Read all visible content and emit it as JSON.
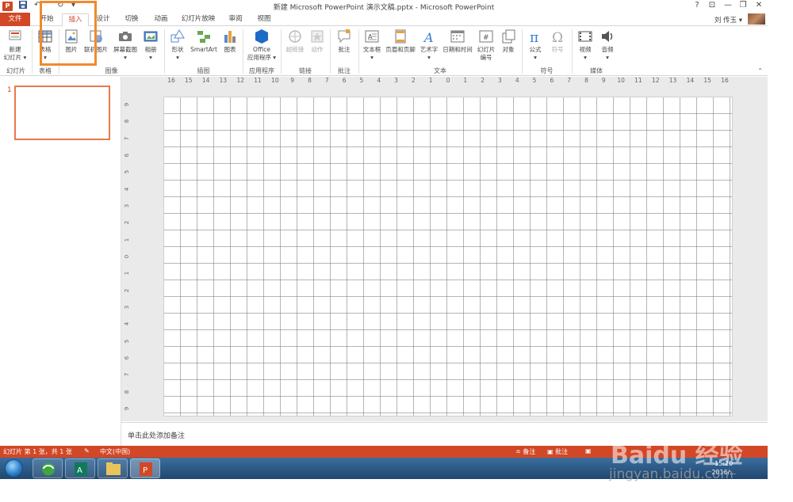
{
  "titlebar": {
    "app_icon": "P",
    "save_icon": "floppy-icon",
    "undo_icon": "↶",
    "redo_icon": "↻",
    "customize_icon": "▾",
    "title": "新建 Microsoft PowerPoint 演示文稿.pptx - Microsoft PowerPoint",
    "help": "?",
    "ribbon_display": "⊡",
    "minimize": "—",
    "restore": "❐",
    "close": "✕"
  },
  "tabs": [
    "文件",
    "开始",
    "插入",
    "设计",
    "切换",
    "动画",
    "幻灯片放映",
    "审阅",
    "视图"
  ],
  "active_tab": "插入",
  "user": {
    "name": "刘 传玉 ▾"
  },
  "ribbon": {
    "buttons": [
      {
        "label": "新建\n幻灯片 ▾",
        "icon": "new-slide-icon"
      },
      {
        "label": "表格\n▾",
        "icon": "table-icon"
      },
      {
        "label": "图片",
        "icon": "picture-icon"
      },
      {
        "label": "联机图片",
        "icon": "online-picture-icon"
      },
      {
        "label": "屏幕截图\n▾",
        "icon": "screenshot-icon"
      },
      {
        "label": "相册\n▾",
        "icon": "photo-album-icon"
      },
      {
        "label": "形状\n▾",
        "icon": "shapes-icon"
      },
      {
        "label": "SmartArt",
        "icon": "smartart-icon"
      },
      {
        "label": "图表",
        "icon": "chart-icon"
      },
      {
        "label": "Office\n应用程序 ▾",
        "icon": "office-apps-icon"
      },
      {
        "label": "超链接",
        "icon": "hyperlink-icon",
        "disabled": true
      },
      {
        "label": "动作",
        "icon": "action-icon",
        "disabled": true
      },
      {
        "label": "批注",
        "icon": "comment-icon"
      },
      {
        "label": "文本框\n▾",
        "icon": "textbox-icon"
      },
      {
        "label": "页眉和页脚",
        "icon": "header-footer-icon"
      },
      {
        "label": "艺术字\n▾",
        "icon": "wordart-icon"
      },
      {
        "label": "日期和时间",
        "icon": "date-time-icon"
      },
      {
        "label": "幻灯片\n编号",
        "icon": "slide-number-icon"
      },
      {
        "label": "对象",
        "icon": "object-icon"
      },
      {
        "label": "公式\n▾",
        "icon": "equation-icon"
      },
      {
        "label": "符号",
        "icon": "symbol-icon",
        "disabled": true
      },
      {
        "label": "视频\n▾",
        "icon": "video-icon"
      },
      {
        "label": "音频\n▾",
        "icon": "audio-icon"
      }
    ],
    "groups": [
      "幻灯片",
      "表格",
      "图像",
      "插图",
      "应用程序",
      "链接",
      "批注",
      "文本",
      "符号",
      "媒体"
    ],
    "collapse": "⌃"
  },
  "ruler": {
    "horizontal": [
      "16",
      "15",
      "14",
      "13",
      "12",
      "11",
      "10",
      "9",
      "8",
      "7",
      "6",
      "5",
      "4",
      "3",
      "2",
      "1",
      "0",
      "1",
      "2",
      "3",
      "4",
      "5",
      "6",
      "7",
      "8",
      "9",
      "10",
      "11",
      "12",
      "13",
      "14",
      "15",
      "16"
    ],
    "vertical": [
      "9",
      "8",
      "7",
      "6",
      "5",
      "4",
      "3",
      "2",
      "1",
      "0",
      "1",
      "2",
      "3",
      "4",
      "5",
      "6",
      "7",
      "8",
      "9"
    ]
  },
  "thumbnails": {
    "number": "1"
  },
  "notes": {
    "placeholder": "单击此处添加备注"
  },
  "status": {
    "slide_info": "幻灯片 第 1 张，共 1 张",
    "language": "中文(中国)",
    "notes_btn": "≐ 备注",
    "comments_btn": "▣ 批注"
  },
  "taskbar": {
    "time": "15:20",
    "date": "2016/..."
  },
  "watermark": {
    "logo": "Baidu 经验",
    "sub": "jingyan.baidu.com"
  }
}
